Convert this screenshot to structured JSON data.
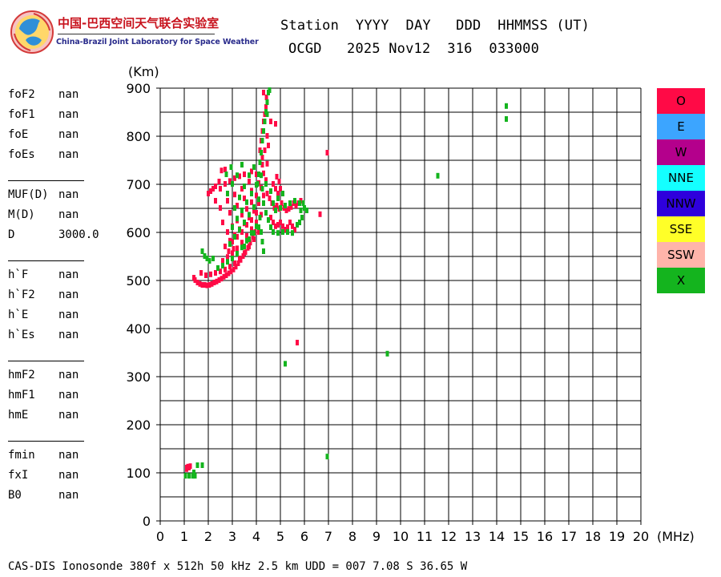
{
  "logo": {
    "name_cn": "中国-巴西空间天气联合实验室",
    "name_en": "China-Brazil Joint Laboratory for Space Weather"
  },
  "header": {
    "row1": "Station  YYYY  DAY   DDD  HHMMSS (UT)",
    "row2": "OCGD   2025 Nov12  316  033000"
  },
  "params": [
    {
      "group": [
        {
          "key": "foF2",
          "value": "nan"
        },
        {
          "key": "foF1",
          "value": "nan"
        },
        {
          "key": "foE",
          "value": "nan"
        },
        {
          "key": "foEs",
          "value": "nan"
        }
      ]
    },
    {
      "group": [
        {
          "key": "MUF(D)",
          "value": "nan"
        },
        {
          "key": "M(D)",
          "value": "nan"
        },
        {
          "key": "D",
          "value": "3000.0"
        }
      ]
    },
    {
      "group": [
        {
          "key": "h`F",
          "value": "nan"
        },
        {
          "key": "h`F2",
          "value": "nan"
        },
        {
          "key": "h`E",
          "value": "nan"
        },
        {
          "key": "h`Es",
          "value": "nan"
        }
      ]
    },
    {
      "group": [
        {
          "key": "hmF2",
          "value": "nan"
        },
        {
          "key": "hmF1",
          "value": "nan"
        },
        {
          "key": "hmE",
          "value": "nan"
        }
      ]
    },
    {
      "group": [
        {
          "key": "fmin",
          "value": "nan"
        },
        {
          "key": "fxI",
          "value": "nan"
        },
        {
          "key": "B0",
          "value": "nan"
        }
      ]
    }
  ],
  "chart_data": {
    "type": "scatter",
    "title": "",
    "xlabel": "(MHz)",
    "ylabel": "(Km)",
    "xlim": [
      0,
      20
    ],
    "ylim": [
      0,
      900
    ],
    "x_ticks": [
      0,
      1,
      2,
      3,
      4,
      5,
      6,
      7,
      8,
      9,
      10,
      11,
      12,
      13,
      14,
      15,
      16,
      17,
      18,
      19,
      20
    ],
    "y_ticks": [
      0,
      100,
      200,
      300,
      400,
      500,
      600,
      700,
      800,
      900
    ],
    "grid": true,
    "legend": "right",
    "x_tick_step": 1,
    "y_grid_step": 50,
    "legend_items": [
      {
        "label": "O",
        "color": "#ff0a46"
      },
      {
        "label": "E",
        "color": "#3ca5ff"
      },
      {
        "label": "W",
        "color": "#b4008c"
      },
      {
        "label": "NNE",
        "color": "#14ffff"
      },
      {
        "label": "NNW",
        "color": "#2e00dc"
      },
      {
        "label": "SSE",
        "color": "#ffff28"
      },
      {
        "label": "SSW",
        "color": "#ffb4aa"
      },
      {
        "label": "X",
        "color": "#14b41e"
      }
    ],
    "series": [
      {
        "name": "O",
        "color": "#ff0a46",
        "points": [
          [
            1.1,
            110
          ],
          [
            1.15,
            112
          ],
          [
            1.2,
            110
          ],
          [
            1.25,
            113
          ],
          [
            1.1,
            107
          ],
          [
            1.4,
            505
          ],
          [
            1.45,
            500
          ],
          [
            1.55,
            495
          ],
          [
            1.65,
            492
          ],
          [
            1.75,
            490
          ],
          [
            1.85,
            490
          ],
          [
            1.95,
            489
          ],
          [
            2.05,
            490
          ],
          [
            2.15,
            492
          ],
          [
            2.25,
            495
          ],
          [
            2.35,
            497
          ],
          [
            2.45,
            500
          ],
          [
            2.55,
            503
          ],
          [
            2.65,
            507
          ],
          [
            2.75,
            510
          ],
          [
            2.85,
            514
          ],
          [
            2.95,
            518
          ],
          [
            3.05,
            522
          ],
          [
            3.15,
            528
          ],
          [
            3.25,
            535
          ],
          [
            3.35,
            542
          ],
          [
            3.45,
            550
          ],
          [
            3.55,
            558
          ],
          [
            3.65,
            567
          ],
          [
            3.75,
            578
          ],
          [
            3.85,
            590
          ],
          [
            3.95,
            600
          ],
          [
            1.7,
            515
          ],
          [
            1.9,
            510
          ],
          [
            2.1,
            512
          ],
          [
            2.3,
            515
          ],
          [
            2.5,
            518
          ],
          [
            2.7,
            522
          ],
          [
            2.9,
            528
          ],
          [
            3.1,
            535
          ],
          [
            3.3,
            545
          ],
          [
            3.5,
            556
          ],
          [
            3.7,
            570
          ],
          [
            3.9,
            585
          ],
          [
            4.1,
            600
          ],
          [
            2.6,
            540
          ],
          [
            2.8,
            548
          ],
          [
            3.0,
            556
          ],
          [
            3.2,
            566
          ],
          [
            3.4,
            578
          ],
          [
            3.6,
            592
          ],
          [
            3.8,
            606
          ],
          [
            4.0,
            620
          ],
          [
            4.2,
            636
          ],
          [
            2.7,
            570
          ],
          [
            2.9,
            582
          ],
          [
            3.1,
            594
          ],
          [
            3.3,
            606
          ],
          [
            3.5,
            618
          ],
          [
            3.7,
            630
          ],
          [
            3.9,
            644
          ],
          [
            4.1,
            660
          ],
          [
            4.3,
            676
          ],
          [
            2.8,
            600
          ],
          [
            3.0,
            612
          ],
          [
            3.2,
            624
          ],
          [
            3.4,
            636
          ],
          [
            3.6,
            648
          ],
          [
            3.8,
            662
          ],
          [
            4.0,
            676
          ],
          [
            4.2,
            692
          ],
          [
            4.4,
            708
          ],
          [
            2.6,
            620
          ],
          [
            2.9,
            640
          ],
          [
            3.2,
            655
          ],
          [
            3.5,
            670
          ],
          [
            3.8,
            686
          ],
          [
            4.1,
            702
          ],
          [
            4.3,
            722
          ],
          [
            4.45,
            742
          ],
          [
            2.5,
            650
          ],
          [
            2.8,
            665
          ],
          [
            3.1,
            678
          ],
          [
            3.4,
            690
          ],
          [
            3.7,
            705
          ],
          [
            4.0,
            720
          ],
          [
            4.25,
            740
          ],
          [
            2.3,
            665
          ],
          [
            2.5,
            690
          ],
          [
            2.7,
            700
          ],
          [
            2.9,
            706
          ],
          [
            3.1,
            712
          ],
          [
            3.3,
            716
          ],
          [
            3.5,
            720
          ],
          [
            3.8,
            726
          ],
          [
            2.0,
            680
          ],
          [
            2.1,
            685
          ],
          [
            2.2,
            690
          ],
          [
            2.3,
            695
          ],
          [
            2.45,
            705
          ],
          [
            2.55,
            728
          ],
          [
            2.7,
            730
          ],
          [
            4.15,
            770
          ],
          [
            4.2,
            790
          ],
          [
            4.25,
            810
          ],
          [
            4.3,
            830
          ],
          [
            4.35,
            845
          ],
          [
            4.4,
            860
          ],
          [
            4.42,
            880
          ],
          [
            4.3,
            890
          ],
          [
            4.45,
            800
          ],
          [
            4.5,
            780
          ],
          [
            4.6,
            830
          ],
          [
            4.8,
            825
          ],
          [
            4.25,
            755
          ],
          [
            4.35,
            770
          ],
          [
            4.45,
            680
          ],
          [
            4.55,
            670
          ],
          [
            4.65,
            660
          ],
          [
            4.75,
            650
          ],
          [
            4.85,
            655
          ],
          [
            4.95,
            648
          ],
          [
            5.05,
            660
          ],
          [
            5.15,
            650
          ],
          [
            5.25,
            645
          ],
          [
            5.35,
            648
          ],
          [
            5.45,
            652
          ],
          [
            5.55,
            660
          ],
          [
            5.65,
            655
          ],
          [
            5.75,
            660
          ],
          [
            5.85,
            665
          ],
          [
            4.6,
            630
          ],
          [
            4.7,
            620
          ],
          [
            4.8,
            612
          ],
          [
            4.9,
            615
          ],
          [
            5.0,
            620
          ],
          [
            5.1,
            612
          ],
          [
            5.2,
            605
          ],
          [
            5.3,
            610
          ],
          [
            5.4,
            620
          ],
          [
            5.5,
            612
          ],
          [
            5.6,
            605
          ],
          [
            5.7,
            615
          ],
          [
            4.7,
            700
          ],
          [
            4.8,
            690
          ],
          [
            4.9,
            680
          ],
          [
            5.0,
            690
          ],
          [
            4.85,
            715
          ],
          [
            4.95,
            705
          ],
          [
            3.0,
            580
          ],
          [
            3.2,
            590
          ],
          [
            3.4,
            600
          ],
          [
            3.6,
            615
          ],
          [
            3.8,
            625
          ],
          [
            4.0,
            640
          ],
          [
            2.85,
            560
          ],
          [
            3.05,
            565
          ],
          [
            6.65,
            637
          ],
          [
            6.95,
            765
          ],
          [
            5.7,
            370
          ]
        ]
      },
      {
        "name": "X",
        "color": "#14b41e",
        "points": [
          [
            1.05,
            93
          ],
          [
            1.2,
            93
          ],
          [
            1.35,
            93
          ],
          [
            1.45,
            93
          ],
          [
            1.55,
            115
          ],
          [
            1.75,
            115
          ],
          [
            1.4,
            100
          ],
          [
            1.75,
            560
          ],
          [
            1.85,
            550
          ],
          [
            1.95,
            545
          ],
          [
            2.05,
            540
          ],
          [
            2.2,
            545
          ],
          [
            2.4,
            525
          ],
          [
            2.6,
            530
          ],
          [
            2.8,
            538
          ],
          [
            3.0,
            545
          ],
          [
            3.2,
            555
          ],
          [
            3.4,
            568
          ],
          [
            3.6,
            582
          ],
          [
            3.8,
            598
          ],
          [
            4.0,
            612
          ],
          [
            4.15,
            630
          ],
          [
            2.9,
            575
          ],
          [
            3.1,
            590
          ],
          [
            3.3,
            605
          ],
          [
            3.5,
            620
          ],
          [
            3.7,
            636
          ],
          [
            3.9,
            652
          ],
          [
            4.1,
            668
          ],
          [
            4.25,
            690
          ],
          [
            3.0,
            610
          ],
          [
            3.2,
            628
          ],
          [
            3.4,
            645
          ],
          [
            3.6,
            662
          ],
          [
            3.8,
            680
          ],
          [
            4.0,
            698
          ],
          [
            4.2,
            718
          ],
          [
            3.1,
            650
          ],
          [
            3.3,
            672
          ],
          [
            3.5,
            695
          ],
          [
            3.7,
            718
          ],
          [
            3.9,
            735
          ],
          [
            2.8,
            680
          ],
          [
            3.0,
            700
          ],
          [
            3.2,
            718
          ],
          [
            3.4,
            740
          ],
          [
            2.75,
            720
          ],
          [
            2.95,
            735
          ],
          [
            4.05,
            700
          ],
          [
            4.1,
            720
          ],
          [
            4.15,
            745
          ],
          [
            4.2,
            765
          ],
          [
            4.25,
            790
          ],
          [
            4.3,
            810
          ],
          [
            4.35,
            830
          ],
          [
            4.4,
            850
          ],
          [
            4.45,
            870
          ],
          [
            4.5,
            890
          ],
          [
            4.55,
            895
          ],
          [
            4.45,
            845
          ],
          [
            4.3,
            660
          ],
          [
            4.4,
            640
          ],
          [
            4.5,
            625
          ],
          [
            4.6,
            610
          ],
          [
            4.7,
            600
          ],
          [
            4.9,
            598
          ],
          [
            5.1,
            600
          ],
          [
            5.3,
            600
          ],
          [
            5.5,
            598
          ],
          [
            5.7,
            615
          ],
          [
            4.8,
            645
          ],
          [
            5.0,
            650
          ],
          [
            5.2,
            655
          ],
          [
            5.4,
            660
          ],
          [
            5.6,
            665
          ],
          [
            5.8,
            660
          ],
          [
            6.0,
            650
          ],
          [
            6.1,
            645
          ],
          [
            4.7,
            660
          ],
          [
            4.9,
            670
          ],
          [
            5.1,
            680
          ],
          [
            4.6,
            685
          ],
          [
            4.4,
            700
          ],
          [
            4.2,
            600
          ],
          [
            4.25,
            580
          ],
          [
            4.3,
            560
          ],
          [
            4.1,
            610
          ],
          [
            3.5,
            570
          ],
          [
            3.7,
            585
          ],
          [
            3.9,
            598
          ],
          [
            5.95,
            660
          ],
          [
            5.85,
            645
          ],
          [
            5.9,
            630
          ],
          [
            5.8,
            620
          ],
          [
            5.2,
            326
          ],
          [
            6.95,
            133
          ],
          [
            9.45,
            347
          ],
          [
            11.55,
            717
          ],
          [
            14.4,
            835
          ],
          [
            14.4,
            862
          ]
        ]
      }
    ]
  },
  "footer": "CAS-DIS Ionosonde 380f x 512h 50 kHz 2.5 km UDD = 007 7.08 S 36.65 W"
}
